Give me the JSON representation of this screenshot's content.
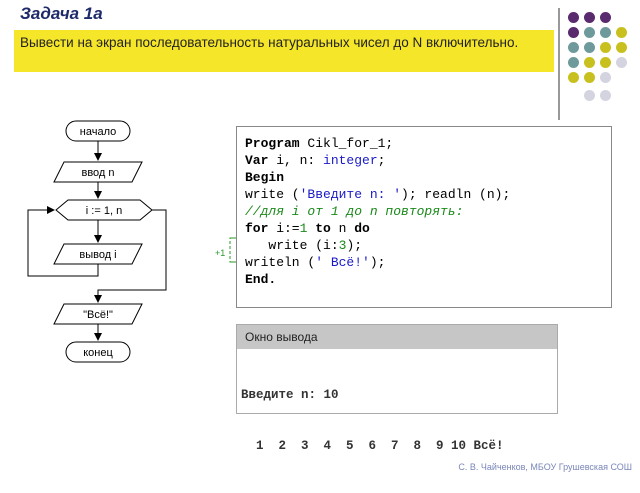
{
  "slide": {
    "title": "Задача 1a",
    "task": "Вывести на экран последовательность натуральных чисел до N включительно.",
    "footer": "С. В. Чайченков, МБОУ Грушевская СОШ"
  },
  "flowchart": {
    "start": "начало",
    "input": "ввод n",
    "loop": "i := 1, n",
    "output": "вывод i",
    "print": "\"Всё!\"",
    "end": "конец"
  },
  "code": {
    "line1_kw": "Program",
    "line1_rest": " Cikl_for_1;",
    "line2_kw": "Var",
    "line2_mid": " i, n: ",
    "line2_type": "integer",
    "line2_end": ";",
    "line3_kw": "Begin",
    "line4_a": "write (",
    "line4_str": "'Введите n: '",
    "line4_b": "); readln (n);",
    "line5_comment": "//для i от 1 до n повторять:",
    "line6_kw1": "for",
    "line6_a": " i:=",
    "line6_num1": "1",
    "line6_kw2": " to",
    "line6_b": " n ",
    "line6_kw3": "do",
    "line7_a": "   write (i:",
    "line7_num": "3",
    "line7_b": ");",
    "line8_a": "writeln (",
    "line8_str": "' Всё!'",
    "line8_b": ");",
    "line9_kw": "End."
  },
  "increment_label": "+1",
  "output_window": {
    "title": "Окно вывода",
    "line1": "Введите n: 10",
    "line2": "  1  2  3  4  5  6  7  8  9 10 Всё!"
  },
  "colors": {
    "accent_yellow": "#f5e62a",
    "dot_purple": "#5a2a6e",
    "dot_teal": "#6e9a9c",
    "dot_olive": "#c8c01e",
    "dot_light": "#d4d4e0"
  }
}
